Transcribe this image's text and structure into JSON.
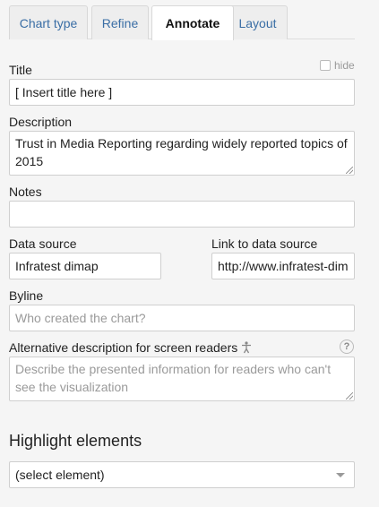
{
  "tabs": [
    {
      "label": "Chart type",
      "active": false
    },
    {
      "label": "Refine",
      "active": false
    },
    {
      "label": "Annotate",
      "active": true
    },
    {
      "label": "Layout",
      "active": false
    }
  ],
  "title_field": {
    "label": "Title",
    "hide_label": "hide",
    "hide_checked": false,
    "value": "[ Insert title here ]"
  },
  "description_field": {
    "label": "Description",
    "value": "Trust in Media Reporting regarding widely reported topics of 2015"
  },
  "notes_field": {
    "label": "Notes",
    "value": ""
  },
  "data_source_field": {
    "label": "Data source",
    "value": "Infratest dimap"
  },
  "link_field": {
    "label": "Link to data source",
    "value": "http://www.infratest-dim"
  },
  "byline_field": {
    "label": "Byline",
    "placeholder": "Who created the chart?"
  },
  "alt_description_field": {
    "label": "Alternative description for screen readers",
    "placeholder": "Describe the presented information for readers who can't see the visualization",
    "help_icon": "?"
  },
  "highlight": {
    "title": "Highlight elements",
    "selected": "(select element)"
  },
  "colors": {
    "accent": "#3a6ea5",
    "tab_bg": "#eeeeee",
    "border": "#cfcfcf"
  }
}
